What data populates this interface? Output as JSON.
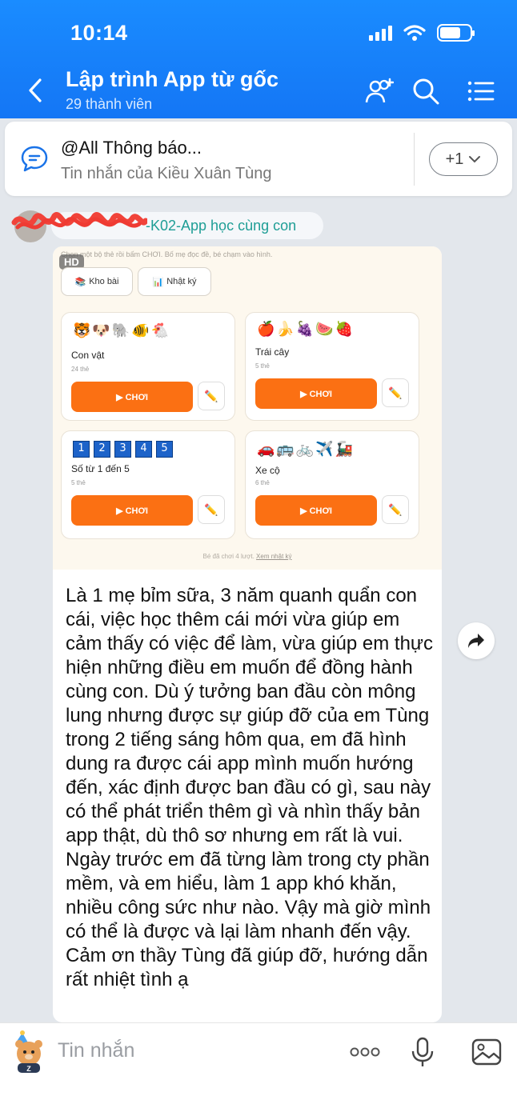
{
  "status": {
    "time": "10:14"
  },
  "header": {
    "title": "Lập trình App từ gốc",
    "subtitle": "29 thành viên"
  },
  "pinned": {
    "title": "@All Thông báo...",
    "subtitle": "Tin nhắn của Kiều Xuân Tùng",
    "more_label": "+1"
  },
  "sender": {
    "name": "-K02-App học cùng con"
  },
  "screenshot": {
    "hint": "Chọn một bộ thẻ rồi bấm CHƠI. Bố mẹ đọc đề, bé chạm vào hình.",
    "hd_badge": "HD",
    "tabs": [
      {
        "icon": "📚",
        "label": "Kho bài"
      },
      {
        "icon": "📊",
        "label": "Nhật ký"
      }
    ],
    "cards": [
      {
        "emojis": "🐯🐶🐘🐠🐔",
        "name": "Con vật",
        "count": "24 thẻ",
        "play": "▶ CHƠI"
      },
      {
        "emojis": "🍎🍌🍇🍉🍓",
        "name": "Trái cây",
        "count": "5 thẻ",
        "play": "▶ CHƠI"
      },
      {
        "numbers": [
          "1",
          "2",
          "3",
          "4",
          "5"
        ],
        "name": "Số từ 1 đến 5",
        "count": "5 thẻ",
        "play": "▶ CHƠI"
      },
      {
        "emojis": "🚗🚌🚲✈️🚂",
        "name": "Xe cộ",
        "count": "6 thẻ",
        "play": "▶ CHƠI"
      }
    ],
    "footer_text": "Bé đã chơi 4 lượt.",
    "footer_link": "Xem nhật ký"
  },
  "message": {
    "text": "Là 1 mẹ bỉm sữa, 3 năm quanh quẩn con cái, việc học thêm cái mới vừa giúp em cảm thấy có việc để làm, vừa giúp em thực hiện những điều em muốn để đồng hành cùng con. Dù ý tưởng ban đầu còn mông lung nhưng được sự giúp đỡ của em Tùng trong 2 tiếng sáng hôm qua, em đã hình dung ra được cái app mình muốn hướng đến, xác định được ban đầu có gì, sau này có thể phát triển thêm gì và nhìn thấy bản app thật, dù thô sơ nhưng em rất là vui. Ngày trước em đã từng làm trong cty phần mềm, và em hiểu, làm 1 app khó khăn, nhiều công sức như nào. Vậy mà giờ mình có thể là được và lại làm nhanh đến vậy. Cảm ơn thầy Tùng đã giúp đỡ, hướng dẫn rất nhiệt tình ạ"
  },
  "input": {
    "placeholder": "Tin nhắn"
  },
  "colors": {
    "header": "#1476f5",
    "accent_orange": "#fb7013",
    "sender_name": "#1f9e96"
  }
}
